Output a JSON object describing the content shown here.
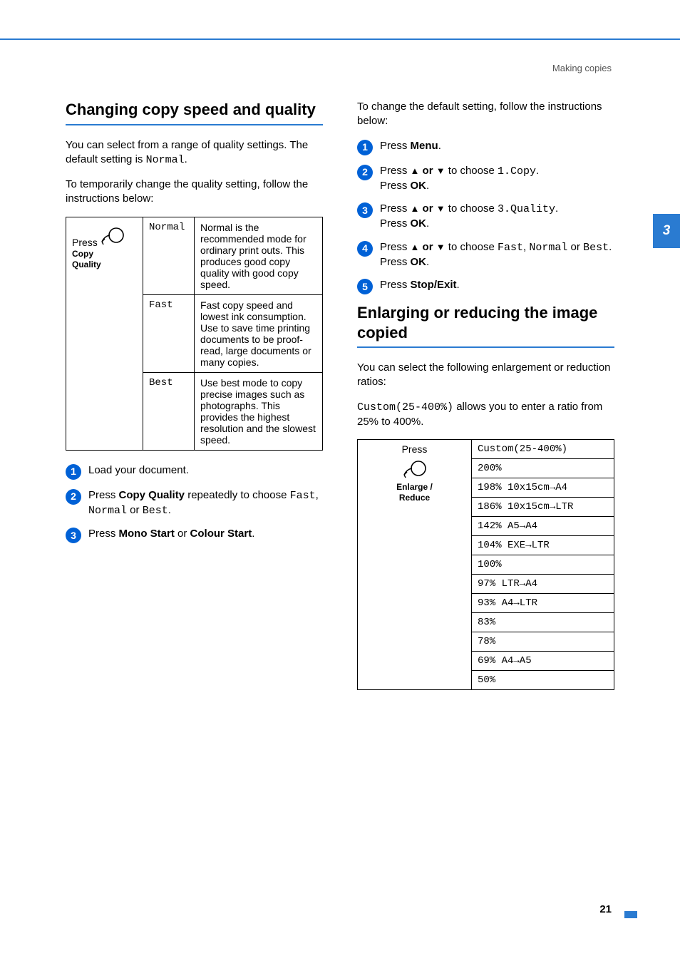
{
  "breadcrumb": "Making copies",
  "side_tab": "3",
  "page_number": "21",
  "left": {
    "heading": "Changing copy speed and quality",
    "intro1_a": "You can select from a range of quality settings. The default setting is ",
    "intro1_b": "Normal",
    "intro1_c": ".",
    "intro2": "To temporarily change the quality setting, follow the instructions below:",
    "table": {
      "press_label": "Press",
      "button_line1": "Copy",
      "button_line2": "Quality",
      "rows": [
        {
          "mode": "Normal",
          "desc": "Normal is the recommended mode for ordinary print outs. This produces good copy quality with good copy speed."
        },
        {
          "mode": "Fast",
          "desc": "Fast copy speed and lowest ink consumption. Use to save time printing documents to be proof-read, large documents or many copies."
        },
        {
          "mode": "Best",
          "desc": "Use best mode to copy precise images such as photographs. This provides the highest resolution and the slowest speed."
        }
      ]
    },
    "steps": {
      "s1": "Load your document.",
      "s2_a": "Press ",
      "s2_b": "Copy Quality",
      "s2_c": " repeatedly to choose ",
      "s2_d": "Fast",
      "s2_e": ", ",
      "s2_f": "Normal",
      "s2_g": " or ",
      "s2_h": "Best",
      "s2_i": ".",
      "s3_a": "Press ",
      "s3_b": "Mono Start",
      "s3_c": " or ",
      "s3_d": "Colour Start",
      "s3_e": "."
    }
  },
  "right": {
    "intro": "To change the default setting, follow the instructions below:",
    "steps": {
      "s1_a": "Press ",
      "s1_b": "Menu",
      "s1_c": ".",
      "s2_a": "Press ",
      "s2_arrows": "▲ or ▼",
      "s2_b": " to choose ",
      "s2_c": "1.Copy",
      "s2_d": ".",
      "s2_e": "Press ",
      "s2_f": "OK",
      "s2_g": ".",
      "s3_a": "Press ",
      "s3_arrows": "▲ or ▼",
      "s3_b": " to choose ",
      "s3_c": "3.Quality",
      "s3_d": ".",
      "s3_e": "Press ",
      "s3_f": "OK",
      "s3_g": ".",
      "s4_a": "Press ",
      "s4_arrows": "▲ or ▼",
      "s4_b": " to choose ",
      "s4_c": "Fast",
      "s4_d": ", ",
      "s4_e": "Normal",
      "s4_f": " or ",
      "s4_g": "Best",
      "s4_h": ".",
      "s4_i": "Press ",
      "s4_j": "OK",
      "s4_k": ".",
      "s5_a": "Press ",
      "s5_b": "Stop/Exit",
      "s5_c": "."
    },
    "heading2": "Enlarging or reducing the image copied",
    "intro2": "You can select the following enlargement or reduction ratios:",
    "intro3_a": "Custom(25-400%)",
    "intro3_b": " allows you to enter a ratio from 25% to 400%.",
    "ratios": {
      "press_label": "Press",
      "button_line1": "Enlarge /",
      "button_line2": "Reduce",
      "values": [
        "Custom(25-400%)",
        "200%",
        "198% 10x15cm→A4",
        "186% 10x15cm→LTR",
        "142% A5→A4",
        "104% EXE→LTR",
        "100%",
        "97% LTR→A4",
        "93% A4→LTR",
        "83%",
        "78%",
        "69% A4→A5",
        "50%"
      ]
    }
  }
}
